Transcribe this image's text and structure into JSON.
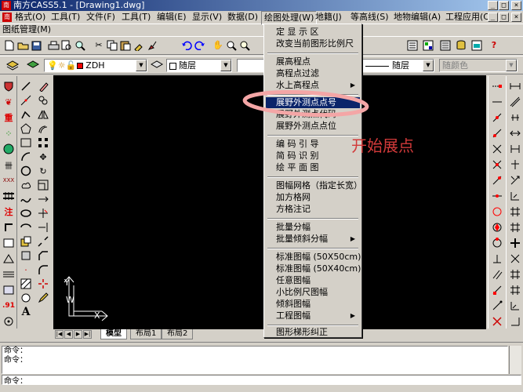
{
  "titlebar": {
    "title": "南方CASS5.1 - [Drawing1.dwg]",
    "win_controls": [
      "_",
      "□",
      "×"
    ]
  },
  "menubar": {
    "items": [
      {
        "label": "格式(O)"
      },
      {
        "label": "工具(T)"
      },
      {
        "label": "文件(F)"
      },
      {
        "label": "工具(T)"
      },
      {
        "label": "编辑(E)"
      },
      {
        "label": "显示(V)"
      },
      {
        "label": "数据(D)"
      },
      {
        "label": "绘图处理(W)"
      },
      {
        "label": "地籍(J)"
      },
      {
        "label": "等高线(S)"
      },
      {
        "label": "地物编辑(A)"
      },
      {
        "label": "工程应用(C)"
      }
    ],
    "second_row_label": "图纸管理(M)",
    "doc_controls": [
      "_",
      "□",
      "×"
    ]
  },
  "layers_toolbar": {
    "layer_name": "ZDH",
    "color_combo": "随层",
    "linetype_combo": "随层",
    "color2": "随颜色"
  },
  "dropdown_menu": {
    "items": [
      {
        "label": "定 显 示 区"
      },
      {
        "label": "改变当前图形比例尺"
      },
      {
        "label": "展高程点"
      },
      {
        "label": "高程点过滤"
      },
      {
        "label": "水上高程点",
        "submenu": true
      },
      {
        "label": "展野外测点点号",
        "highlighted": true
      },
      {
        "label": "展野外测点代码"
      },
      {
        "label": "展野外测点点位"
      },
      {
        "label": "编 码 引 导"
      },
      {
        "label": "简 码 识 别"
      },
      {
        "label": "绘 平 面 图"
      },
      {
        "label": "图幅网格（指定长宽）"
      },
      {
        "label": "加方格网"
      },
      {
        "label": "方格注记"
      },
      {
        "label": "批量分幅"
      },
      {
        "label": "批量倾斜分幅",
        "submenu": true
      },
      {
        "label": "标准图幅 (50X50cm)"
      },
      {
        "label": "标准图幅 (50X40cm)"
      },
      {
        "label": "任意图幅"
      },
      {
        "label": "小比例尺图幅"
      },
      {
        "label": "倾斜图幅"
      },
      {
        "label": "工程图幅",
        "submenu": true
      },
      {
        "label": "图形梯形纠正"
      }
    ]
  },
  "annotation": {
    "text": "开始展点",
    "color": "#d23a3a"
  },
  "side_tool_texts": {
    "zhong": "重",
    "zhu": "注",
    "num": ".91"
  },
  "drawing": {
    "ucs_y": "Y",
    "ucs_w": "W",
    "ucs_x": "X"
  },
  "layout_tabs": [
    {
      "label": "模型",
      "active": true
    },
    {
      "label": "布局1"
    },
    {
      "label": "布局2"
    }
  ],
  "command_lines": [
    "命令：",
    "命令：",
    "命令："
  ],
  "colors": {
    "canvas": "#000000",
    "highlight": "#0a246a",
    "title_bar": "#0a246a",
    "ui": "#d4d0c8",
    "ellipse": "#f4a6a6"
  }
}
